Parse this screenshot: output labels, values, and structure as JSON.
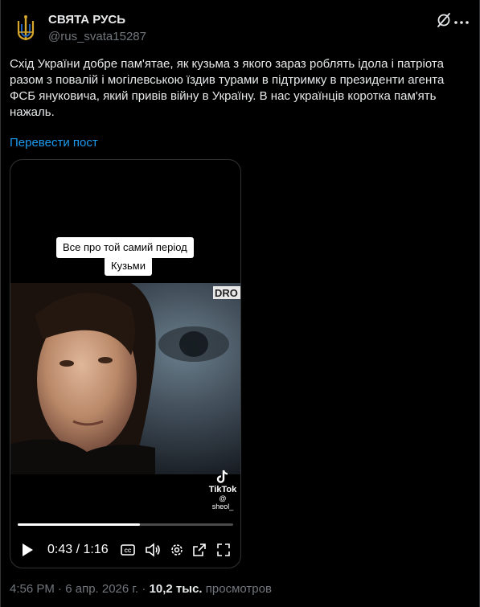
{
  "author": {
    "name": "СВЯТА РУСЬ",
    "handle": "@rus_svata15287",
    "avatar_icon": "trident-coat-of-arms-icon"
  },
  "post": {
    "text": "Схід України добре пам'ятае, як кузьма з якого зараз роблять ідола і патріота разом з повалій і могілевською їздив турами в підтримку в президенти агента ФСБ януковича, який привів війну в Україну. В нас українців коротка пам'ять нажаль.",
    "translate_link": "Перевести пост"
  },
  "video": {
    "caption_line1": "Все про той самий період",
    "caption_line2": "Кузьми",
    "corner_logo": "DRO",
    "watermark": "TikTok",
    "watermark_user": "@ sheol_",
    "current_time": "0:43",
    "duration": "1:16",
    "time_display": "0:43 / 1:16",
    "progress_fraction": 0.566
  },
  "meta": {
    "time": "4:56 PM",
    "separator": "·",
    "date": "6 апр. 2026 г.",
    "views_count": "10,2 тыс.",
    "views_label": "просмотров"
  },
  "colors": {
    "background": "#000000",
    "text": "#e7e9ea",
    "secondary": "#71767b",
    "link": "#1d9bf0",
    "border": "#2f3336"
  }
}
